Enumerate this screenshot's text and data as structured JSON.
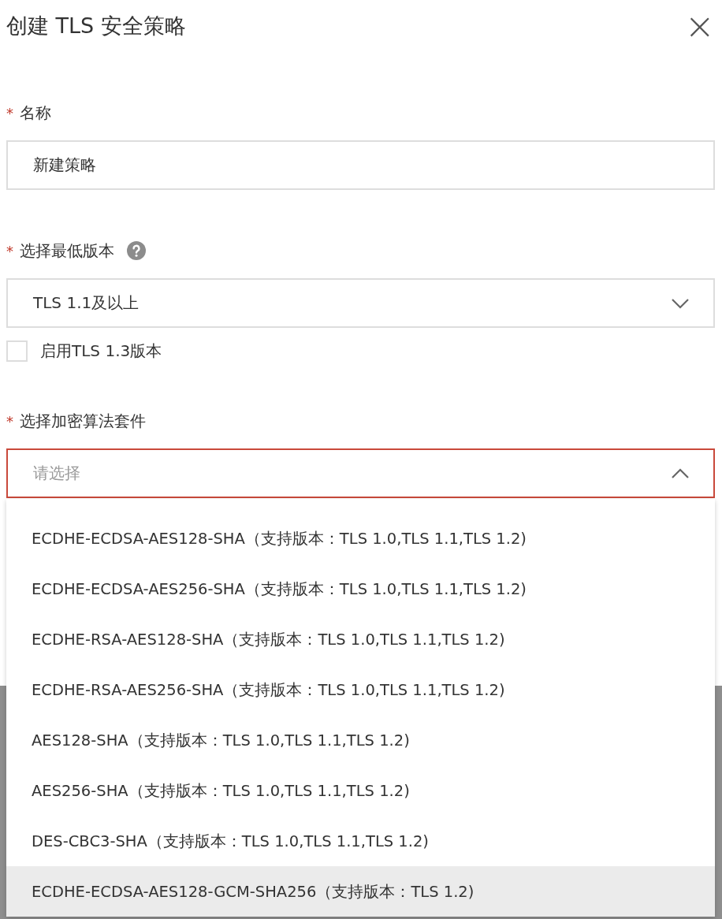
{
  "dialog": {
    "title": "创建 TLS 安全策略",
    "close": "×"
  },
  "fields": [
    {
      "kind": "input",
      "required": "*",
      "label": "名称",
      "help": false,
      "value": "新建策略"
    },
    {
      "kind": "select",
      "required": "*",
      "label": "选择最低版本",
      "help": true,
      "value": "TLS 1.1及以上",
      "expanded": false,
      "error": false
    },
    {
      "kind": "checkbox",
      "label": "启用TLS 1.3版本",
      "checked": false
    },
    {
      "kind": "select",
      "required": "*",
      "label": "选择加密算法套件",
      "help": false,
      "placeholder": "请选择",
      "expanded": true,
      "error": true
    }
  ],
  "dropdown": {
    "options": [
      {
        "label": "ECDHE-ECDSA-AES128-SHA（支持版本：TLS 1.0,TLS 1.1,TLS 1.2)",
        "highlighted": false
      },
      {
        "label": "ECDHE-ECDSA-AES256-SHA（支持版本：TLS 1.0,TLS 1.1,TLS 1.2)",
        "highlighted": false
      },
      {
        "label": "ECDHE-RSA-AES128-SHA（支持版本：TLS 1.0,TLS 1.1,TLS 1.2)",
        "highlighted": false
      },
      {
        "label": "ECDHE-RSA-AES256-SHA（支持版本：TLS 1.0,TLS 1.1,TLS 1.2)",
        "highlighted": false
      },
      {
        "label": "AES128-SHA（支持版本：TLS 1.0,TLS 1.1,TLS 1.2)",
        "highlighted": false
      },
      {
        "label": "AES256-SHA（支持版本：TLS 1.0,TLS 1.1,TLS 1.2)",
        "highlighted": false
      },
      {
        "label": "DES-CBC3-SHA（支持版本：TLS 1.0,TLS 1.1,TLS 1.2)",
        "highlighted": false
      },
      {
        "label": "ECDHE-ECDSA-AES128-GCM-SHA256（支持版本：TLS 1.2)",
        "highlighted": true
      }
    ]
  }
}
